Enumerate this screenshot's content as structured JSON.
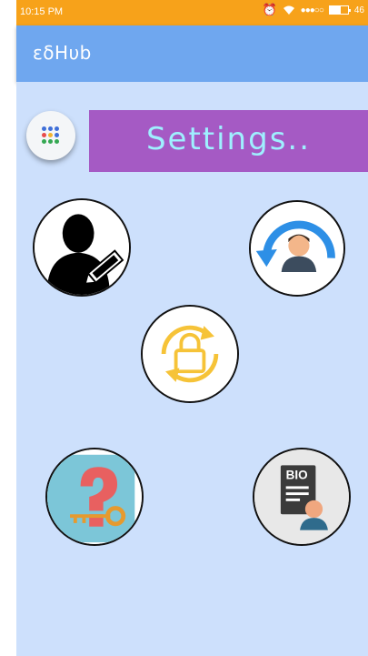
{
  "status_bar": {
    "time": "10:15 PM",
    "battery_label": "46"
  },
  "app_bar": {
    "title": "εδHυb"
  },
  "banner": {
    "title": "Settings.."
  },
  "colors": {
    "status_bar": "#f7a21a",
    "app_bar": "#6fa7ef",
    "content_bg": "#cde0fc",
    "banner_bg": "#a55ac4",
    "banner_text": "#9ff0ff",
    "accent_yellow": "#f6c338",
    "refresh_blue": "#2d8fe6",
    "question_red": "#e86060",
    "key_orange": "#e69a2e"
  },
  "icons": {
    "menu": "app-grid-icon",
    "edit_profile": "edit-profile-icon",
    "refresh_profile": "refresh-profile-icon",
    "change_password": "lock-refresh-icon",
    "forgot_password": "question-key-icon",
    "bio": "bio-document-icon"
  }
}
